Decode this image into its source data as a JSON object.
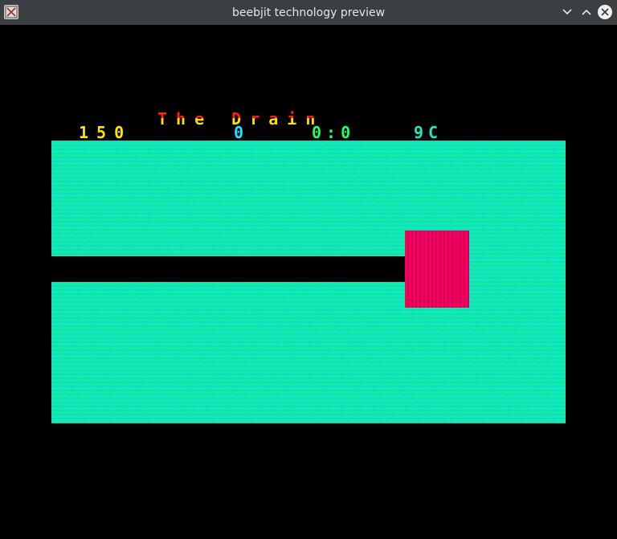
{
  "window": {
    "title": "beebjit technology preview"
  },
  "hud": {
    "game_title": "The Drain",
    "score": "150",
    "lives": "0",
    "timer": "0:0",
    "level": "9C"
  },
  "colors": {
    "titlebar": "#3b3f42",
    "background": "#000000",
    "water": "#18f090",
    "plug": "#ff0050",
    "score": "#ffe400",
    "lives": "#20e0ff",
    "timer": "#20ff60"
  },
  "icons": {
    "app": "beebjit-app-icon",
    "minimize": "chevron-down-icon",
    "maximize": "chevron-up-icon",
    "close": "close-icon"
  }
}
